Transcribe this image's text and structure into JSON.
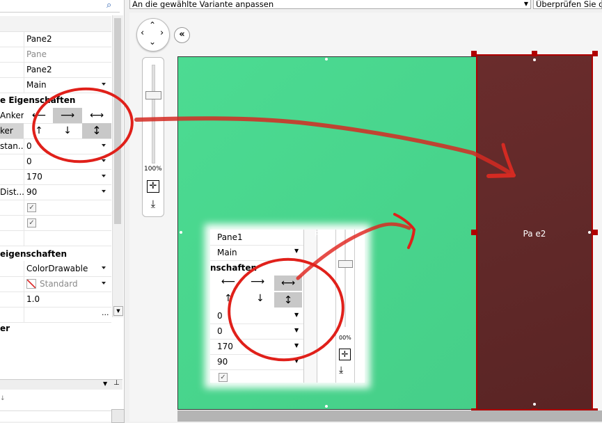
{
  "search_icon": "search-icon",
  "properties": {
    "rows": [
      {
        "label": "",
        "value": "Pane2",
        "dropdown": false,
        "grey": false
      },
      {
        "label": "",
        "value": "Pane",
        "dropdown": false,
        "grey": true
      },
      {
        "label": "",
        "value": "Pane2",
        "dropdown": false,
        "grey": false
      },
      {
        "label": "",
        "value": "Main",
        "dropdown": true,
        "grey": false
      }
    ],
    "section_layout": "e Eigenschaften",
    "anchor_rows": [
      {
        "label": "Anker"
      },
      {
        "label": "ker"
      }
    ],
    "rows2": [
      {
        "label": "stan...",
        "value": "0",
        "dropdown": true
      },
      {
        "label": "",
        "value": "0",
        "dropdown": true
      },
      {
        "label": "",
        "value": "170",
        "dropdown": true
      },
      {
        "label": "Dist...",
        "value": "90",
        "dropdown": true
      }
    ],
    "section_other": "eigenschaften",
    "rows3": [
      {
        "label": "",
        "value": "ColorDrawable",
        "dropdown": true
      },
      {
        "label": "",
        "value": "Standard",
        "dropdown": true
      },
      {
        "label": "",
        "value": "1.0",
        "dropdown": false
      }
    ],
    "section_last": "er",
    "ellipsis": "..."
  },
  "toolbar": {
    "variant_combo": "An die gewählte Variante anpassen",
    "check_combo": "Überprüfen Sie die"
  },
  "zoom": {
    "label": "100%",
    "value": 100
  },
  "canvas": {
    "pane1_color": "#4cdb92",
    "pane2_color": "#632a2a",
    "pane2_label": "Pa​ e2",
    "selection_color": "#b00000"
  },
  "zoom_inset": {
    "pane_label": "Pane1",
    "row_pane": "Pane1",
    "row_main": "Main",
    "section": "nschaften",
    "rows": [
      "0",
      "0",
      "170",
      "90"
    ],
    "zoom_label": "00%"
  },
  "annotation_color": "#e0201a"
}
